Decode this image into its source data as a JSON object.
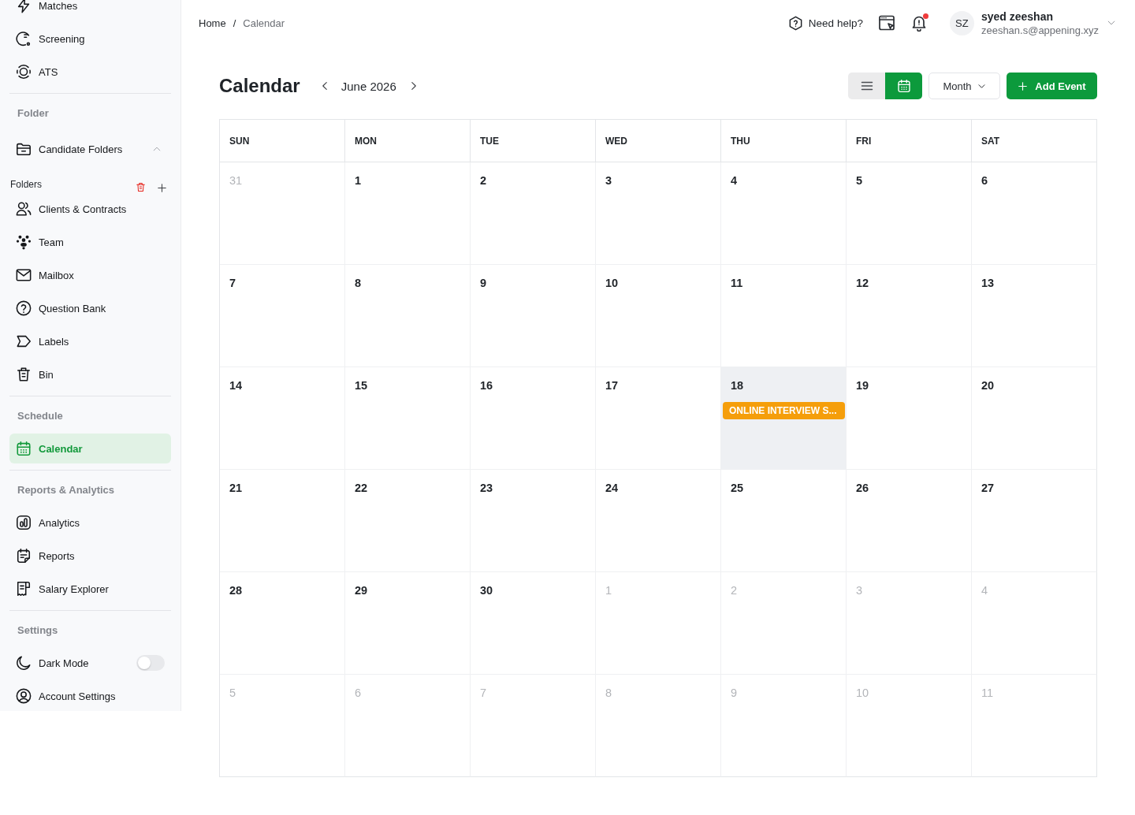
{
  "sidebar": {
    "sections": [
      {
        "items": [
          {
            "label": "Matches",
            "kind": "link",
            "selected": false
          },
          {
            "label": "Screening",
            "kind": "link",
            "selected": false
          },
          {
            "label": "ATS",
            "kind": "link",
            "selected": false
          }
        ]
      },
      {
        "heading": "Folder",
        "items": [
          {
            "label": "Candidate Folders",
            "kind": "expandable",
            "expanded": true,
            "selected": false
          }
        ],
        "subheading": "Folders",
        "subitems": [
          {
            "label": "Clients & Contracts",
            "kind": "link",
            "selected": false
          },
          {
            "label": "Team",
            "kind": "link",
            "selected": false
          },
          {
            "label": "Mailbox",
            "kind": "link",
            "selected": false
          },
          {
            "label": "Question Bank",
            "kind": "link",
            "selected": false
          },
          {
            "label": "Labels",
            "kind": "link",
            "selected": false
          },
          {
            "label": "Bin",
            "kind": "link",
            "selected": false
          }
        ]
      },
      {
        "heading": "Schedule",
        "items": [
          {
            "label": "Calendar",
            "kind": "link",
            "selected": true
          }
        ]
      },
      {
        "heading": "Reports & Analytics",
        "items": [
          {
            "label": "Analytics",
            "kind": "link",
            "selected": false
          },
          {
            "label": "Reports",
            "kind": "link",
            "selected": false
          },
          {
            "label": "Salary Explorer",
            "kind": "link",
            "selected": false
          }
        ]
      },
      {
        "heading": "Settings",
        "items": [
          {
            "label": "Dark Mode",
            "kind": "toggle",
            "on": false
          },
          {
            "label": "Account Settings",
            "kind": "link",
            "selected": false
          }
        ]
      }
    ]
  },
  "breadcrumb": {
    "separator": "/",
    "items": [
      {
        "label": "Home",
        "current": false
      },
      {
        "label": "Calendar",
        "current": true
      }
    ]
  },
  "topbar": {
    "help_label": "Need help?",
    "notifications": {
      "unread": true
    },
    "user": {
      "initials": "SZ",
      "name": "syed zeeshan",
      "email": "zeeshan.s@appening.xyz"
    }
  },
  "calendar": {
    "title": "Calendar",
    "period": "June 2026",
    "views": [
      {
        "kind": "list",
        "selected": false
      },
      {
        "kind": "calendar",
        "selected": true
      }
    ],
    "range_dropdown": "Month",
    "add_button": "Add Event",
    "weekdays": [
      "SUN",
      "MON",
      "TUE",
      "WED",
      "THU",
      "FRI",
      "SAT"
    ],
    "weeks": [
      [
        {
          "day": "31",
          "in_month": false,
          "today": false
        },
        {
          "day": "1",
          "in_month": true,
          "today": false
        },
        {
          "day": "2",
          "in_month": true,
          "today": false
        },
        {
          "day": "3",
          "in_month": true,
          "today": false
        },
        {
          "day": "4",
          "in_month": true,
          "today": false
        },
        {
          "day": "5",
          "in_month": true,
          "today": false
        },
        {
          "day": "6",
          "in_month": true,
          "today": false
        }
      ],
      [
        {
          "day": "7",
          "in_month": true,
          "today": false
        },
        {
          "day": "8",
          "in_month": true,
          "today": false
        },
        {
          "day": "9",
          "in_month": true,
          "today": false
        },
        {
          "day": "10",
          "in_month": true,
          "today": false
        },
        {
          "day": "11",
          "in_month": true,
          "today": false
        },
        {
          "day": "12",
          "in_month": true,
          "today": false
        },
        {
          "day": "13",
          "in_month": true,
          "today": false
        }
      ],
      [
        {
          "day": "14",
          "in_month": true,
          "today": false
        },
        {
          "day": "15",
          "in_month": true,
          "today": false
        },
        {
          "day": "16",
          "in_month": true,
          "today": false
        },
        {
          "day": "17",
          "in_month": true,
          "today": false
        },
        {
          "day": "18",
          "in_month": true,
          "today": true,
          "events": [
            {
              "title": "ONLINE INTERVIEW S..."
            }
          ]
        },
        {
          "day": "19",
          "in_month": true,
          "today": false
        },
        {
          "day": "20",
          "in_month": true,
          "today": false
        }
      ],
      [
        {
          "day": "21",
          "in_month": true,
          "today": false
        },
        {
          "day": "22",
          "in_month": true,
          "today": false
        },
        {
          "day": "23",
          "in_month": true,
          "today": false
        },
        {
          "day": "24",
          "in_month": true,
          "today": false
        },
        {
          "day": "25",
          "in_month": true,
          "today": false
        },
        {
          "day": "26",
          "in_month": true,
          "today": false
        },
        {
          "day": "27",
          "in_month": true,
          "today": false
        }
      ],
      [
        {
          "day": "28",
          "in_month": true,
          "today": false
        },
        {
          "day": "29",
          "in_month": true,
          "today": false
        },
        {
          "day": "30",
          "in_month": true,
          "today": false
        },
        {
          "day": "1",
          "in_month": false,
          "today": false
        },
        {
          "day": "2",
          "in_month": false,
          "today": false
        },
        {
          "day": "3",
          "in_month": false,
          "today": false
        },
        {
          "day": "4",
          "in_month": false,
          "today": false
        }
      ],
      [
        {
          "day": "5",
          "in_month": false,
          "today": false
        },
        {
          "day": "6",
          "in_month": false,
          "today": false
        },
        {
          "day": "7",
          "in_month": false,
          "today": false
        },
        {
          "day": "8",
          "in_month": false,
          "today": false
        },
        {
          "day": "9",
          "in_month": false,
          "today": false
        },
        {
          "day": "10",
          "in_month": false,
          "today": false
        },
        {
          "day": "11",
          "in_month": false,
          "today": false
        }
      ]
    ]
  }
}
